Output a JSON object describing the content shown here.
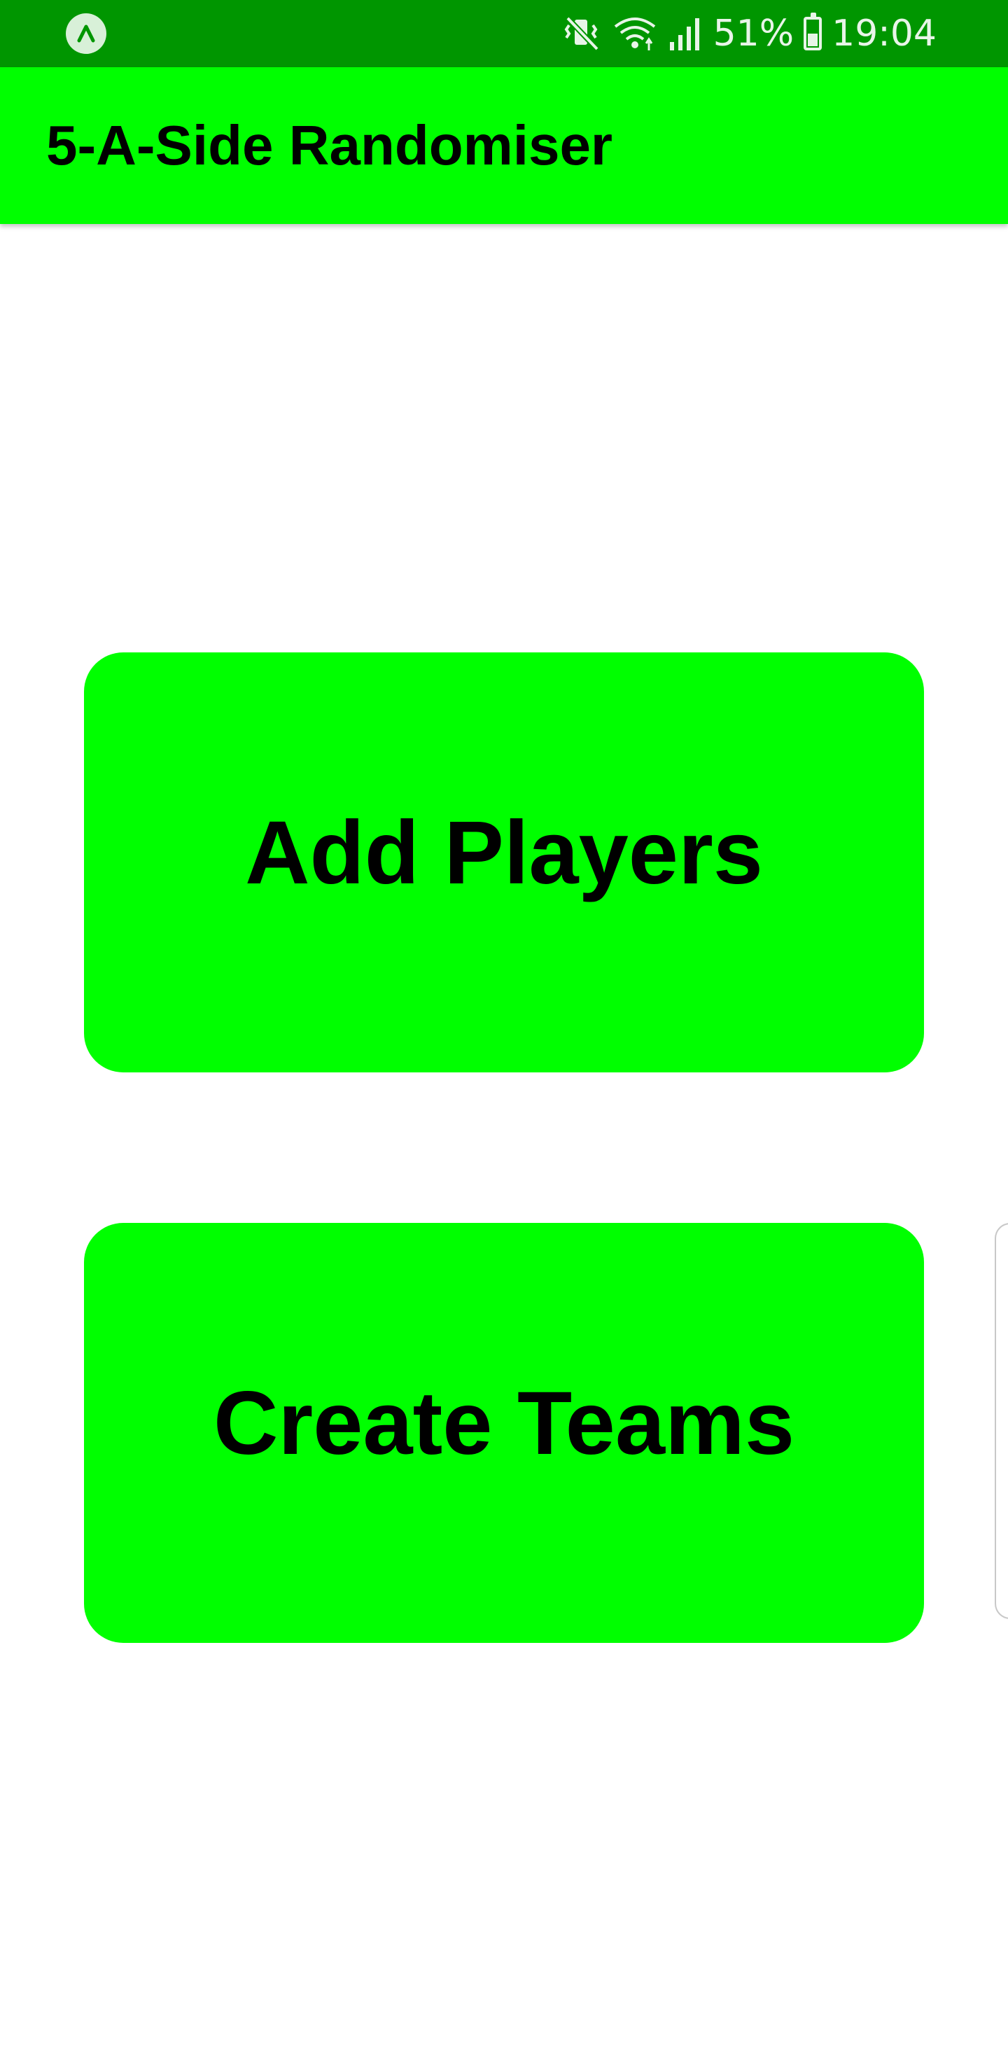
{
  "status_bar": {
    "app_icon": "expo-icon",
    "icons": [
      "vibrate-icon",
      "wifi-icon",
      "signal-icon",
      "battery-icon"
    ],
    "battery_percent_text": "51%",
    "battery_level": 0.51,
    "time": "19:04"
  },
  "app_bar": {
    "title": "5-A-Side Randomiser"
  },
  "buttons": {
    "add_players": "Add Players",
    "create_teams": "Create Teams"
  },
  "colors": {
    "status_bar": "#009600",
    "primary": "#00ff00",
    "text": "#000000",
    "background": "#ffffff"
  }
}
